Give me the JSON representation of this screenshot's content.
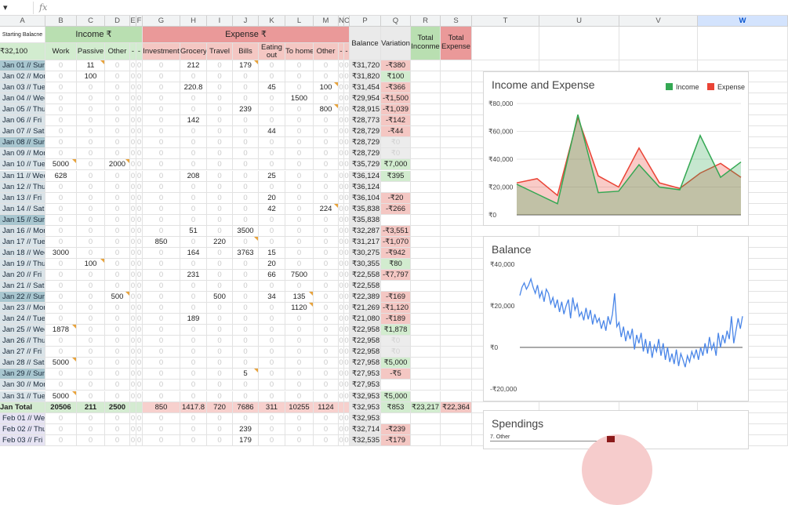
{
  "formula_bar": {
    "name_box": "",
    "fx": "fx"
  },
  "columns": [
    "A",
    "B",
    "C",
    "D",
    "E",
    "F",
    "G",
    "H",
    "I",
    "J",
    "K",
    "L",
    "M",
    "N",
    "O",
    "P",
    "Q",
    "R",
    "S",
    "T",
    "U",
    "V",
    "W"
  ],
  "selected_column": "W",
  "header1": {
    "starting_label": "Starting Balacne",
    "income": "Income ₹",
    "expense": "Expense ₹",
    "balance": "Balance",
    "variation": "Variation",
    "total_income": "Total Inconme",
    "total_expense": "Total Expense"
  },
  "header2": {
    "starting_value": "₹32,100",
    "work": "Work",
    "passive": "Passive",
    "other": "Other",
    "e": "-",
    "f": "-",
    "investment": "Investment",
    "grocery": "Grocery",
    "travel": "Travel",
    "bills": "Bills",
    "eating_out": "Eating out",
    "to_home": "To home",
    "other_exp": "Other",
    "n": "-",
    "o": "-"
  },
  "zero": "0",
  "rows": [
    {
      "d": "Jan 01 // Sun",
      "we": 1,
      "B": "",
      "C": "11",
      "D": "",
      "G": "",
      "H": "212",
      "I": "",
      "J": "179",
      "K": "",
      "L": "",
      "M": "",
      "P": "₹31,720",
      "Q": "-₹380",
      "s": "n"
    },
    {
      "d": "Jan 02 // Mon",
      "we": 0,
      "B": "",
      "C": "100",
      "D": "",
      "G": "",
      "H": "",
      "I": "",
      "J": "",
      "K": "",
      "L": "",
      "M": "",
      "P": "₹31,820",
      "Q": "₹100",
      "s": "p"
    },
    {
      "d": "Jan 03 // Tue",
      "we": 0,
      "B": "",
      "C": "",
      "D": "",
      "G": "",
      "H": "220.8",
      "I": "",
      "J": "",
      "K": "45",
      "L": "",
      "M": "100",
      "P": "₹31,454",
      "Q": "-₹366",
      "s": "n"
    },
    {
      "d": "Jan 04 // Wed",
      "we": 0,
      "B": "",
      "C": "",
      "D": "",
      "G": "",
      "H": "",
      "I": "",
      "J": "",
      "K": "",
      "L": "1500",
      "M": "",
      "P": "₹29,954",
      "Q": "-₹1,500",
      "s": "n"
    },
    {
      "d": "Jan 05 // Thu",
      "we": 0,
      "B": "",
      "C": "",
      "D": "",
      "G": "",
      "H": "",
      "I": "",
      "J": "239",
      "K": "",
      "L": "",
      "M": "800",
      "P": "₹28,915",
      "Q": "-₹1,039",
      "s": "n"
    },
    {
      "d": "Jan 06 // Fri",
      "we": 0,
      "B": "",
      "C": "",
      "D": "",
      "G": "",
      "H": "142",
      "I": "",
      "J": "",
      "K": "",
      "L": "",
      "M": "",
      "P": "₹28,773",
      "Q": "-₹142",
      "s": "n"
    },
    {
      "d": "Jan 07 // Sat",
      "we": 0,
      "B": "",
      "C": "",
      "D": "",
      "G": "",
      "H": "",
      "I": "",
      "J": "",
      "K": "44",
      "L": "",
      "M": "",
      "P": "₹28,729",
      "Q": "-₹44",
      "s": "n"
    },
    {
      "d": "Jan 08 // Sun",
      "we": 1,
      "B": "",
      "C": "",
      "D": "",
      "G": "",
      "H": "",
      "I": "",
      "J": "",
      "K": "",
      "L": "",
      "M": "",
      "P": "₹28,729",
      "Q": "₹0",
      "s": "z"
    },
    {
      "d": "Jan 09 // Mon",
      "we": 0,
      "B": "",
      "C": "",
      "D": "",
      "G": "",
      "H": "",
      "I": "",
      "J": "",
      "K": "",
      "L": "",
      "M": "",
      "P": "₹28,729",
      "Q": "₹0",
      "s": "z"
    },
    {
      "d": "Jan 10 // Tue",
      "we": 0,
      "B": "5000",
      "C": "",
      "D": "2000",
      "G": "",
      "H": "",
      "I": "",
      "J": "",
      "K": "",
      "L": "",
      "M": "",
      "P": "₹35,729",
      "Q": "₹7,000",
      "s": "p"
    },
    {
      "d": "Jan 11 // Wed",
      "we": 0,
      "B": "628",
      "C": "",
      "D": "",
      "G": "",
      "H": "208",
      "I": "",
      "J": "",
      "K": "25",
      "L": "",
      "M": "",
      "P": "₹36,124",
      "Q": "₹395",
      "s": "p"
    },
    {
      "d": "Jan 12 // Thu",
      "we": 0,
      "B": "",
      "C": "",
      "D": "",
      "G": "",
      "H": "",
      "I": "",
      "J": "",
      "K": "",
      "L": "",
      "M": "",
      "P": "₹36,124",
      "Q": "",
      "s": "b"
    },
    {
      "d": "Jan 13 // Fri",
      "we": 0,
      "B": "",
      "C": "",
      "D": "",
      "G": "",
      "H": "",
      "I": "",
      "J": "",
      "K": "20",
      "L": "",
      "M": "",
      "P": "₹36,104",
      "Q": "-₹20",
      "s": "n"
    },
    {
      "d": "Jan 14 // Sat",
      "we": 0,
      "B": "",
      "C": "",
      "D": "",
      "G": "",
      "H": "",
      "I": "",
      "J": "",
      "K": "42",
      "L": "",
      "M": "224",
      "P": "₹35,838",
      "Q": "-₹266",
      "s": "n"
    },
    {
      "d": "Jan 15 // Sun",
      "we": 1,
      "B": "",
      "C": "",
      "D": "",
      "G": "",
      "H": "",
      "I": "",
      "J": "",
      "K": "",
      "L": "",
      "M": "",
      "P": "₹35,838",
      "Q": "",
      "s": "b"
    },
    {
      "d": "Jan 16 // Mon",
      "we": 0,
      "B": "",
      "C": "",
      "D": "",
      "G": "",
      "H": "51",
      "I": "",
      "J": "3500",
      "K": "",
      "L": "",
      "M": "",
      "P": "₹32,287",
      "Q": "-₹3,551",
      "s": "n"
    },
    {
      "d": "Jan 17 // Tue",
      "we": 0,
      "B": "",
      "C": "",
      "D": "",
      "G": "850",
      "H": "",
      "I": "220",
      "J": "",
      "K": "",
      "L": "",
      "M": "",
      "P": "₹31,217",
      "Q": "-₹1,070",
      "s": "n"
    },
    {
      "d": "Jan 18 // Wed",
      "we": 0,
      "B": "3000",
      "C": "",
      "D": "",
      "G": "",
      "H": "164",
      "I": "",
      "J": "3763",
      "K": "15",
      "L": "",
      "M": "",
      "P": "₹30,275",
      "Q": "-₹942",
      "s": "n"
    },
    {
      "d": "Jan 19 // Thu",
      "we": 0,
      "B": "",
      "C": "100",
      "D": "",
      "G": "",
      "H": "",
      "I": "",
      "J": "",
      "K": "20",
      "L": "",
      "M": "",
      "P": "₹30,355",
      "Q": "₹80",
      "s": "p"
    },
    {
      "d": "Jan 20 // Fri",
      "we": 0,
      "B": "",
      "C": "",
      "D": "",
      "G": "",
      "H": "231",
      "I": "",
      "J": "",
      "K": "66",
      "L": "7500",
      "M": "",
      "P": "₹22,558",
      "Q": "-₹7,797",
      "s": "n"
    },
    {
      "d": "Jan 21 // Sat",
      "we": 0,
      "B": "",
      "C": "",
      "D": "",
      "G": "",
      "H": "",
      "I": "",
      "J": "",
      "K": "",
      "L": "",
      "M": "",
      "P": "₹22,558",
      "Q": "",
      "s": "b"
    },
    {
      "d": "Jan 22 // Sun",
      "we": 1,
      "B": "",
      "C": "",
      "D": "500",
      "G": "",
      "H": "",
      "I": "500",
      "J": "",
      "K": "34",
      "L": "135",
      "M": "",
      "P": "₹22,389",
      "Q": "-₹169",
      "s": "n"
    },
    {
      "d": "Jan 23 // Mon",
      "we": 0,
      "B": "",
      "C": "",
      "D": "",
      "G": "",
      "H": "",
      "I": "",
      "J": "",
      "K": "",
      "L": "1120",
      "M": "",
      "P": "₹21,269",
      "Q": "-₹1,120",
      "s": "n"
    },
    {
      "d": "Jan 24 // Tue",
      "we": 0,
      "B": "",
      "C": "",
      "D": "",
      "G": "",
      "H": "189",
      "I": "",
      "J": "",
      "K": "",
      "L": "",
      "M": "",
      "P": "₹21,080",
      "Q": "-₹189",
      "s": "n"
    },
    {
      "d": "Jan 25 // Wed",
      "we": 0,
      "B": "1878",
      "C": "",
      "D": "",
      "G": "",
      "H": "",
      "I": "",
      "J": "",
      "K": "",
      "L": "",
      "M": "",
      "P": "₹22,958",
      "Q": "₹1,878",
      "s": "p"
    },
    {
      "d": "Jan 26 // Thu",
      "we": 0,
      "B": "",
      "C": "",
      "D": "",
      "G": "",
      "H": "",
      "I": "",
      "J": "",
      "K": "",
      "L": "",
      "M": "",
      "P": "₹22,958",
      "Q": "₹0",
      "s": "z"
    },
    {
      "d": "Jan 27 // Fri",
      "we": 0,
      "B": "",
      "C": "",
      "D": "",
      "G": "",
      "H": "",
      "I": "",
      "J": "",
      "K": "",
      "L": "",
      "M": "",
      "P": "₹22,958",
      "Q": "₹0",
      "s": "z"
    },
    {
      "d": "Jan 28 // Sat",
      "we": 0,
      "B": "5000",
      "C": "",
      "D": "",
      "G": "",
      "H": "",
      "I": "",
      "J": "",
      "K": "",
      "L": "",
      "M": "",
      "P": "₹27,958",
      "Q": "₹5,000",
      "s": "p"
    },
    {
      "d": "Jan 29 // Sun",
      "we": 1,
      "B": "",
      "C": "",
      "D": "",
      "G": "",
      "H": "",
      "I": "",
      "J": "5",
      "K": "",
      "L": "",
      "M": "",
      "P": "₹27,953",
      "Q": "-₹5",
      "s": "n"
    },
    {
      "d": "Jan 30 // Mon",
      "we": 0,
      "B": "",
      "C": "",
      "D": "",
      "G": "",
      "H": "",
      "I": "",
      "J": "",
      "K": "",
      "L": "",
      "M": "",
      "P": "₹27,953",
      "Q": "",
      "s": "b"
    },
    {
      "d": "Jan 31 // Tue",
      "we": 0,
      "B": "5000",
      "C": "",
      "D": "",
      "G": "",
      "H": "",
      "I": "",
      "J": "",
      "K": "",
      "L": "",
      "M": "",
      "P": "₹32,953",
      "Q": "₹5,000",
      "s": "p"
    }
  ],
  "total": {
    "d": "Jan Total",
    "B": "20506",
    "C": "211",
    "D": "2500",
    "G": "850",
    "H": "1417.8",
    "I": "720",
    "J": "7686",
    "K": "311",
    "L": "10255",
    "M": "1124",
    "P": "₹32,953",
    "Q": "₹853",
    "R": "₹23,217",
    "S": "₹22,364"
  },
  "feb_rows": [
    {
      "d": "Feb 01 // Wed",
      "B": "",
      "C": "",
      "D": "",
      "G": "",
      "H": "",
      "I": "",
      "J": "",
      "K": "",
      "L": "",
      "M": "",
      "P": "₹32,953",
      "Q": "",
      "s": "b"
    },
    {
      "d": "Feb 02 // Thu",
      "B": "",
      "C": "",
      "D": "",
      "G": "",
      "H": "",
      "I": "",
      "J": "239",
      "K": "",
      "L": "",
      "M": "",
      "P": "₹32,714",
      "Q": "-₹239",
      "s": "n"
    },
    {
      "d": "Feb 03 // Fri",
      "B": "",
      "C": "",
      "D": "",
      "G": "",
      "H": "",
      "I": "",
      "J": "179",
      "K": "",
      "L": "",
      "M": "",
      "P": "₹32,535",
      "Q": "-₹179",
      "s": "n"
    }
  ],
  "chart_data": [
    {
      "type": "area",
      "title": "Income and Expense",
      "legend_position": "top-right",
      "series": [
        {
          "name": "Income",
          "color": "#34a853",
          "values": [
            22000,
            15000,
            8000,
            72000,
            16000,
            17000,
            36000,
            20000,
            18000,
            57000,
            27000,
            38000
          ]
        },
        {
          "name": "Expense",
          "color": "#ea4335",
          "values": [
            23000,
            26000,
            14000,
            70000,
            28000,
            20000,
            48000,
            23000,
            19000,
            30000,
            37000,
            27000
          ]
        }
      ],
      "ylim": [
        0,
        80000
      ],
      "yticks": [
        "₹0",
        "₹20,000",
        "₹40,000",
        "₹60,000",
        "₹80,000"
      ],
      "grid": true
    },
    {
      "type": "line",
      "title": "Balance",
      "color": "#4a86e8",
      "values": [
        25000,
        29000,
        31000,
        28000,
        30000,
        33000,
        29000,
        26000,
        30000,
        24000,
        27000,
        22000,
        28000,
        26000,
        21000,
        24000,
        19000,
        23000,
        17000,
        22000,
        16000,
        20000,
        23000,
        14000,
        24000,
        18000,
        21000,
        15000,
        17000,
        13000,
        19000,
        13500,
        18000,
        11000,
        16000,
        12000,
        14000,
        9000,
        13000,
        8000,
        15000,
        11000,
        16000,
        26000,
        10000,
        12000,
        5000,
        10000,
        3000,
        8000,
        4000,
        9000,
        -1000,
        6000,
        2000,
        7000,
        -2000,
        4000,
        -3000,
        3000,
        -5000,
        1000,
        -2000,
        4000,
        -4000,
        2000,
        -6000,
        0,
        -7000,
        -3000,
        -8000,
        -1000,
        -9000,
        -3000,
        -6000,
        -9500,
        -4000,
        -7000,
        -2000,
        -5000,
        -1000,
        -6000,
        0,
        -4000,
        2000,
        -3000,
        5000,
        -1000,
        2000,
        -4000,
        7000,
        0,
        6000,
        2000,
        8000,
        4000,
        15000,
        2000,
        8000,
        14000,
        9000,
        15000
      ],
      "ylim": [
        -20000,
        40000
      ],
      "yticks": [
        "-₹20,000",
        "₹0",
        "₹20,000",
        "₹40,000"
      ]
    },
    {
      "type": "pie",
      "title": "Spendings",
      "labels": [
        "7. Other"
      ]
    }
  ]
}
